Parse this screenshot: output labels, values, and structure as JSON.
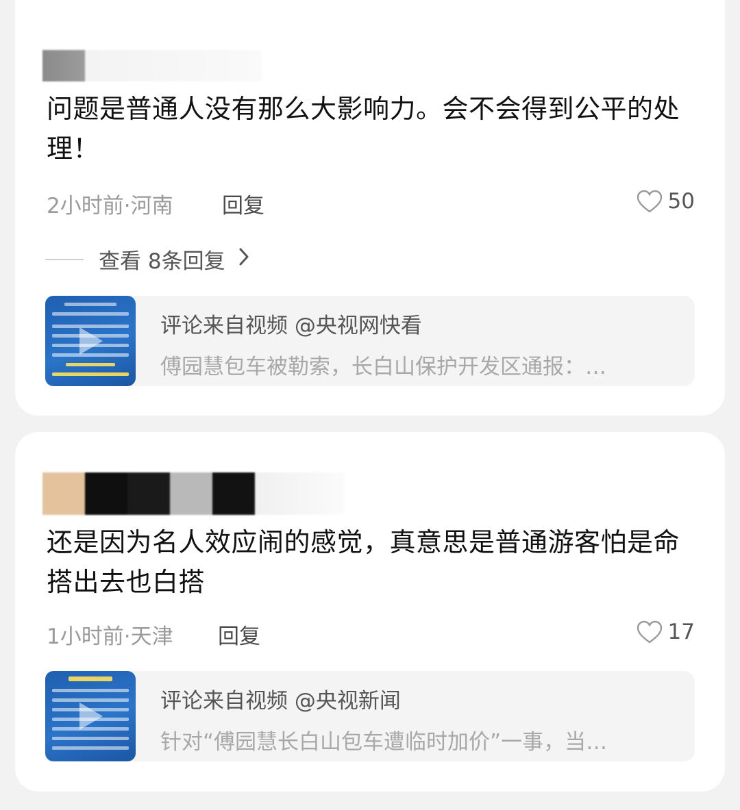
{
  "comments": [
    {
      "text": "问题是普通人没有那么大影响力。会不会得到公平的处理！",
      "time_location": "2小时前·河南",
      "reply_label": "回复",
      "likes": "50",
      "view_replies_label": "查看 8条回复",
      "source": {
        "title": "评论来自视频 @央视网快看",
        "description": "傅园慧包车被勒索，长白山保护开发区通报：…",
        "thumbnail_icon": "video-thumbnail"
      }
    },
    {
      "text": "还是因为名人效应闹的感觉，真意思是普通游客怕是命搭出去也白搭",
      "time_location": "1小时前·天津",
      "reply_label": "回复",
      "likes": "17",
      "source": {
        "title": "评论来自视频 @央视新闻",
        "description": "针对“傅园慧长白山包车遭临时加价”一事，当…",
        "thumbnail_icon": "video-thumbnail"
      }
    }
  ],
  "icons": {
    "like": "heart-outline-icon",
    "chevron": "chevron-right-icon"
  }
}
